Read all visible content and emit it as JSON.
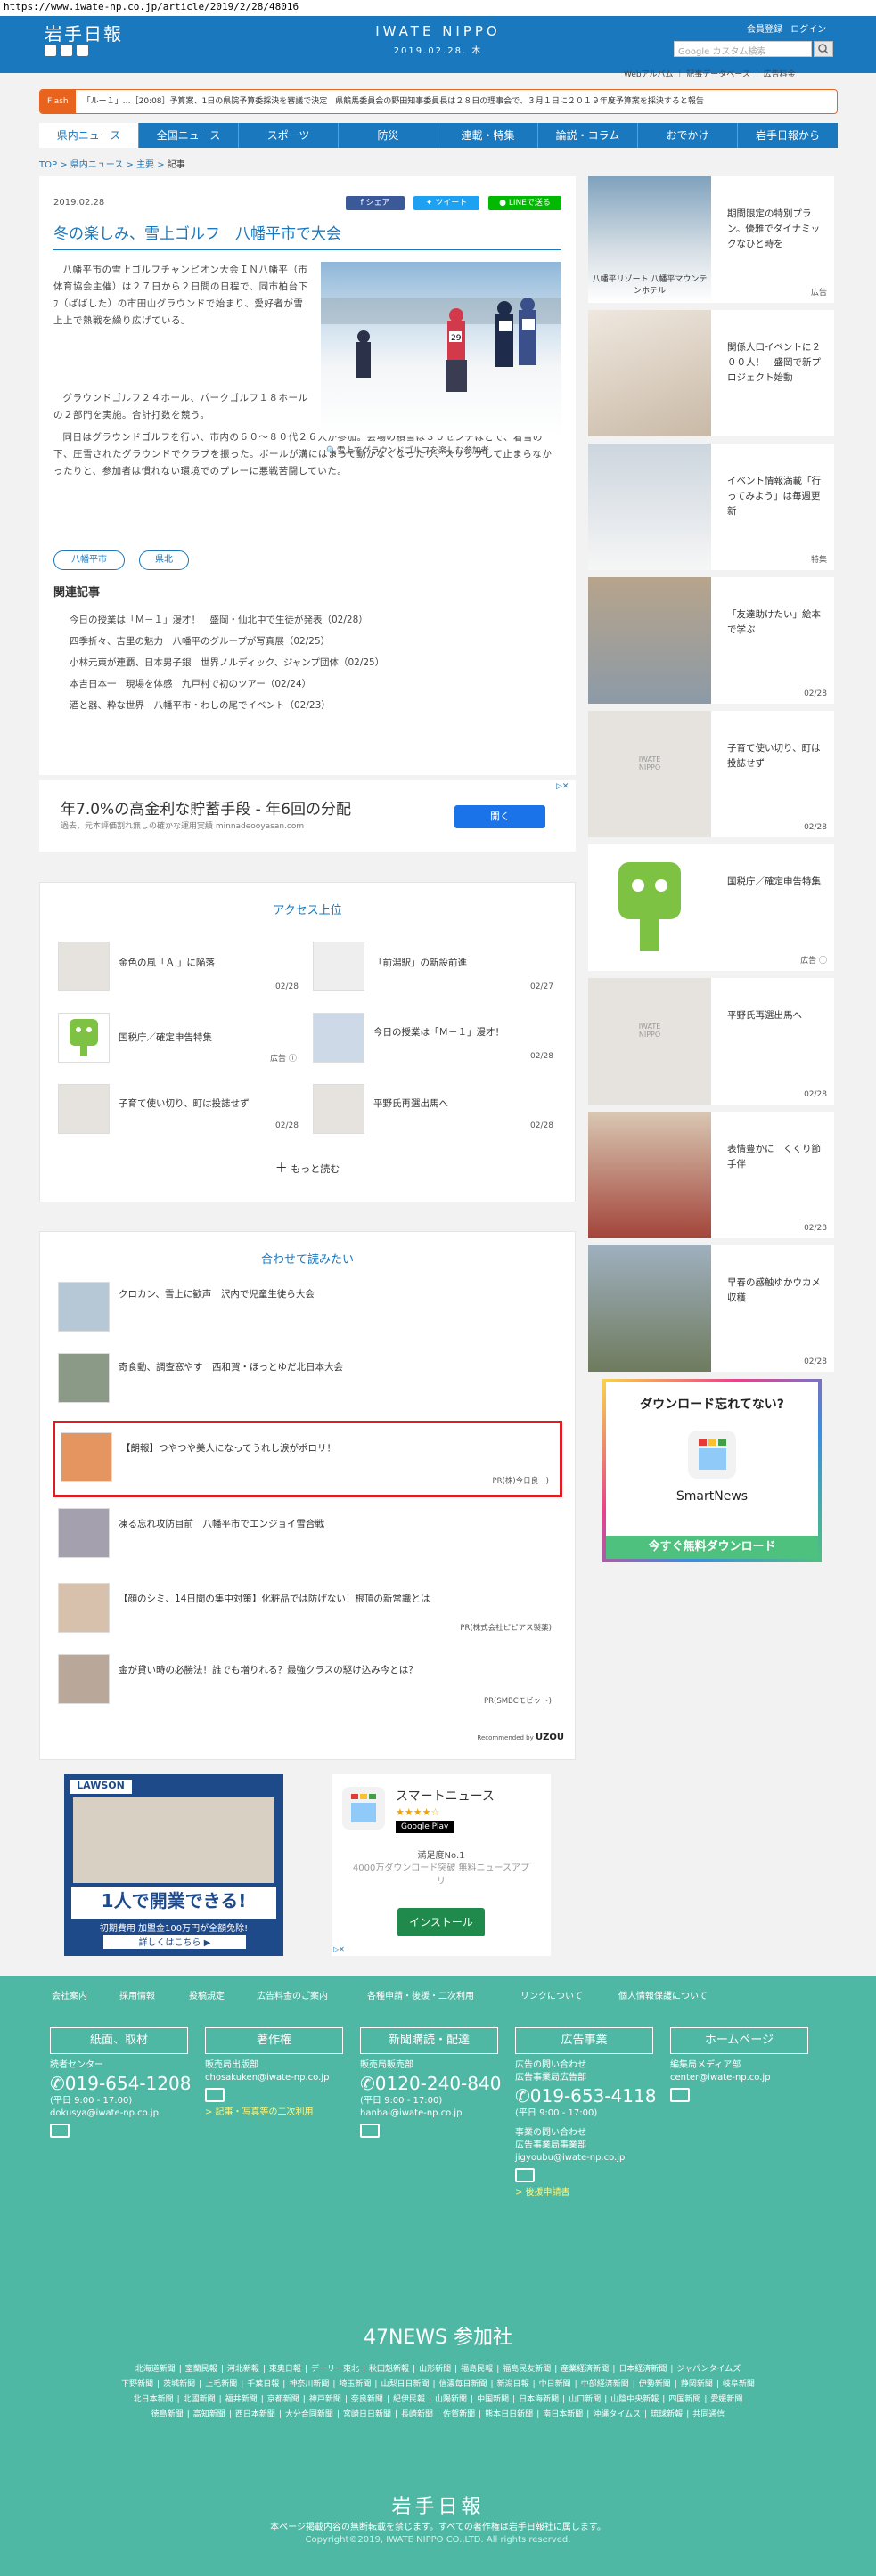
{
  "browser": {
    "url": "https://www.iwate-np.co.jp/article/2019/2/28/48016"
  },
  "header": {
    "logo_jp": "岩手日報",
    "logo_en": "IWATE NIPPO",
    "date": "2019.02.28. 木",
    "member_link": "会員登録",
    "login_link": "ログイン",
    "search_placeholder": "Google カスタム検索",
    "subnav": [
      "Webアルバム",
      "記事データベース",
      "広告料金"
    ]
  },
  "flash": {
    "tag": "Flash",
    "text": "「ルー１」…［20:08］予算案、1日の県院予算委採決を審議で決定　県競馬委員会の野田知事委員長は２８日の理事会で、３月１日に２０１９年度予算案を採決すると報告"
  },
  "nav": [
    "県内ニュース",
    "全国ニュース",
    "スポーツ",
    "防災",
    "連載・特集",
    "論説・コラム",
    "おでかけ",
    "岩手日報から"
  ],
  "breadcrumb": [
    "TOP",
    "県内ニュース",
    "主要",
    "記事"
  ],
  "article": {
    "date": "2019.02.28",
    "share": "シェア",
    "tweet": "ツイート",
    "line": "LINEで送る",
    "title": "冬の楽しみ、雪上ゴルフ　八幡平市で大会",
    "paragraphs": [
      "八幡平市の雪上ゴルフチャンピオン大会ＩＮ八幡平（市体育協会主催）は２７日から２日間の日程で、同市柏台下ﾌ（ばばした）の市田山グラウンドで始まり、愛好者が雪上上で熱戦を繰り広げている。",
      "グラウンドゴルフ２４ホール、パークゴルフ１８ホールの２部門を実施。合計打数を競う。",
      "同日はグラウンドゴルフを行い、市内の６０～８０代２６人が参加。会場の積雪は３０センチほどで、着雪の下、圧雪されたグラウンドでクラブを振った。ボールが溝にはまって動かなくなったり、スリップして止まらなかったりと、参加者は慣れない環境でのプレーに悪戦苦闘していた。"
    ],
    "photo_caption": "雪上でグラウンドゴルフを楽しむ参加者",
    "tags": [
      "八幡平市",
      "県北"
    ],
    "related_heading": "関連記事",
    "related": [
      "今日の授業は「Ｍ－１」漫才！　盛岡・仙北中で生徒が発表（02/28）",
      "四季折々、吉里の魅力　八幡平のグループが写真展（02/25）",
      "小林元東が連覇、日本男子銀　世界ノルディック、ジャンプ団体（02/25）",
      "本吉日本一　現場を体感　九戸村で初のツアー（02/24）",
      "酒と器、粋な世界　八幡平市・わしの尾でイベント（02/23）"
    ]
  },
  "ad_banner": {
    "headline": "年7.0%の高金利な貯蓄手段 - 年6回の分配",
    "sub": "過去、元本評価割れ無しの確かな運用実績 minnadeooyasan.com",
    "button": "開く"
  },
  "access": {
    "title": "アクセス上位",
    "items": [
      {
        "title": "金色の風「Ａ'」に陥落",
        "date": "02/28"
      },
      {
        "title": "「前潟駅」の新設前進",
        "date": "02/27"
      },
      {
        "title": "国税庁／確定申告特集",
        "date": "広告 ⓘ"
      },
      {
        "title": "今日の授業は「Ｍ－１」漫才！",
        "date": "02/28"
      },
      {
        "title": "子育て使い切り、町は投誌せず",
        "date": "02/28"
      },
      {
        "title": "平野氏再選出馬へ",
        "date": "02/28"
      }
    ],
    "more": "もっと読む"
  },
  "recommend": {
    "title": "合わせて読みたい",
    "items": [
      {
        "title": "クロカン、雪上に歓声　沢内で児童生徒ら大会",
        "source": ""
      },
      {
        "title": "奇食動、調查窓やす　西和賀・ほっとゆだ北日本大会",
        "source": ""
      },
      {
        "title": "【朗報】つやつや美人になってうれし涙がポロリ！",
        "source": "PR(株)今日良ー)"
      },
      {
        "title": "凍る忘れ攻防目前　八幡平市でエンジョイ雪合戦",
        "source": ""
      },
      {
        "title": "【顔のシミ、14日間の集中対策】化粧品では防げない！根頂の新常識とは",
        "source": "PR(株式会社ピピアス製薬)"
      },
      {
        "title": "金が貸い時の必勝法！誰でも増りれる？最強クラスの駆け込み今とは？",
        "source": "PR(SMBCモビット)"
      }
    ],
    "credit": "Recommended by",
    "credit_brand": "UZOU"
  },
  "bottom_ads": {
    "lawson_brand": "LAWSON",
    "lawson_headline": "1人で開業できる!",
    "lawson_sub": "初期費用 加盟金100万円が全額免除!",
    "lawson_cta": "詳しくはこちら ▶",
    "smart_title": "スマートニュース",
    "smart_store": "Google Play",
    "smart_rank": "満足度No.1",
    "smart_desc": "4000万ダウンロード突破 無料ニュースアプリ",
    "smart_btn": "インストール"
  },
  "sidebar": [
    {
      "title": "期間限定の特別プラン。優雅でダイナミックなひと時を",
      "date": "広告",
      "caption": "八幡平リゾート 八幡平マウンテンホテル"
    },
    {
      "title": "関係人口イベントに２００人！　盛岡で新プロジェクト始動",
      "date": ""
    },
    {
      "title": "イベント情報満載「行ってみよう」は毎週更新",
      "date": "特集"
    },
    {
      "title": "「友達助けたい」絵本で学ぶ",
      "date": "02/28"
    },
    {
      "title": "子育て使い切り、町は投誌せず",
      "date": "02/28"
    },
    {
      "title": "国税庁／確定申告特集",
      "date": "広告 ⓘ"
    },
    {
      "title": "平野氏再選出馬へ",
      "date": "02/28"
    },
    {
      "title": "表情豊かに　くくり節手伴",
      "date": "02/28"
    },
    {
      "title": "早春の感触ゆかウカメ収穫",
      "date": "02/28"
    }
  ],
  "smartnews_ad": {
    "headline": "ダウンロード忘れてない?",
    "brand": "SmartNews",
    "cta": "今すぐ無料ダウンロード"
  },
  "footer": {
    "nav": [
      "会社案内",
      "採用情報",
      "投稿規定",
      "広告料金のご案内",
      "各種申請・後援・二次利用",
      "リンクについて",
      "個人情報保護について"
    ],
    "buttons": [
      "紙面、取材",
      "著作権",
      "新聞購読・配達",
      "広告事業",
      "ホームページ"
    ],
    "col1": {
      "label": "読者センター",
      "tel": "019-654-1208",
      "hours": "(平日 9:00 - 17:00)",
      "email": "dokusya@iwate-np.co.jp"
    },
    "col2": {
      "label": "販売局出版部",
      "email": "chosakuken@iwate-np.co.jp",
      "link": "> 記事・写真等の二次利用"
    },
    "col3": {
      "label": "販売局販売部",
      "tel": "0120-240-840",
      "hours": "(平日 9:00 - 17:00)",
      "email": "hanbai@iwate-np.co.jp"
    },
    "col4": {
      "label1": "広告の問い合わせ",
      "label2": "広告事業局広告部",
      "tel": "019-653-4118",
      "hours": "(平日 9:00 - 17:00)",
      "label3": "事業の問い合わせ",
      "label4": "広告事業局事業部",
      "email": "jigyoubu@iwate-np.co.jp",
      "link": "> 後援申請書"
    },
    "col5": {
      "label": "編集局メディア部",
      "email": "center@iwate-np.co.jp"
    },
    "news47_title": "47NEWS 参加社",
    "papers": [
      [
        "北海道新聞",
        "室蘭民報",
        "河北新報",
        "東奥日報",
        "デーリー東北",
        "秋田魁新報",
        "山形新聞",
        "福島民報",
        "福島民友新聞",
        "産業経済新聞",
        "日本経済新聞",
        "ジャパンタイムズ"
      ],
      [
        "下野新聞",
        "茨城新聞",
        "上毛新聞",
        "千葉日報",
        "神奈川新聞",
        "埼玉新聞",
        "山梨日日新聞",
        "信濃毎日新聞",
        "新潟日報",
        "中日新聞",
        "中部経済新聞",
        "伊勢新聞",
        "静岡新聞",
        "岐阜新聞"
      ],
      [
        "北日本新聞",
        "北國新聞",
        "福井新聞",
        "京都新聞",
        "神戸新聞",
        "奈良新聞",
        "紀伊民報",
        "山陽新聞",
        "中国新聞",
        "日本海新聞",
        "山口新聞",
        "山陰中央新報",
        "四国新聞",
        "愛媛新聞"
      ],
      [
        "徳島新聞",
        "高知新聞",
        "西日本新聞",
        "大分合同新聞",
        "宮崎日日新聞",
        "長崎新聞",
        "佐賀新聞",
        "熊本日日新聞",
        "南日本新聞",
        "沖縄タイムス",
        "琉球新報",
        "共同通信"
      ]
    ],
    "logo": "岩手日報",
    "notice": "本ページ掲載内容の無断転載を禁じます。すべての著作権は岩手日報社に属します。",
    "copyright": "Copyright©2019, IWATE NIPPO CO.,LTD. All rights reserved."
  }
}
